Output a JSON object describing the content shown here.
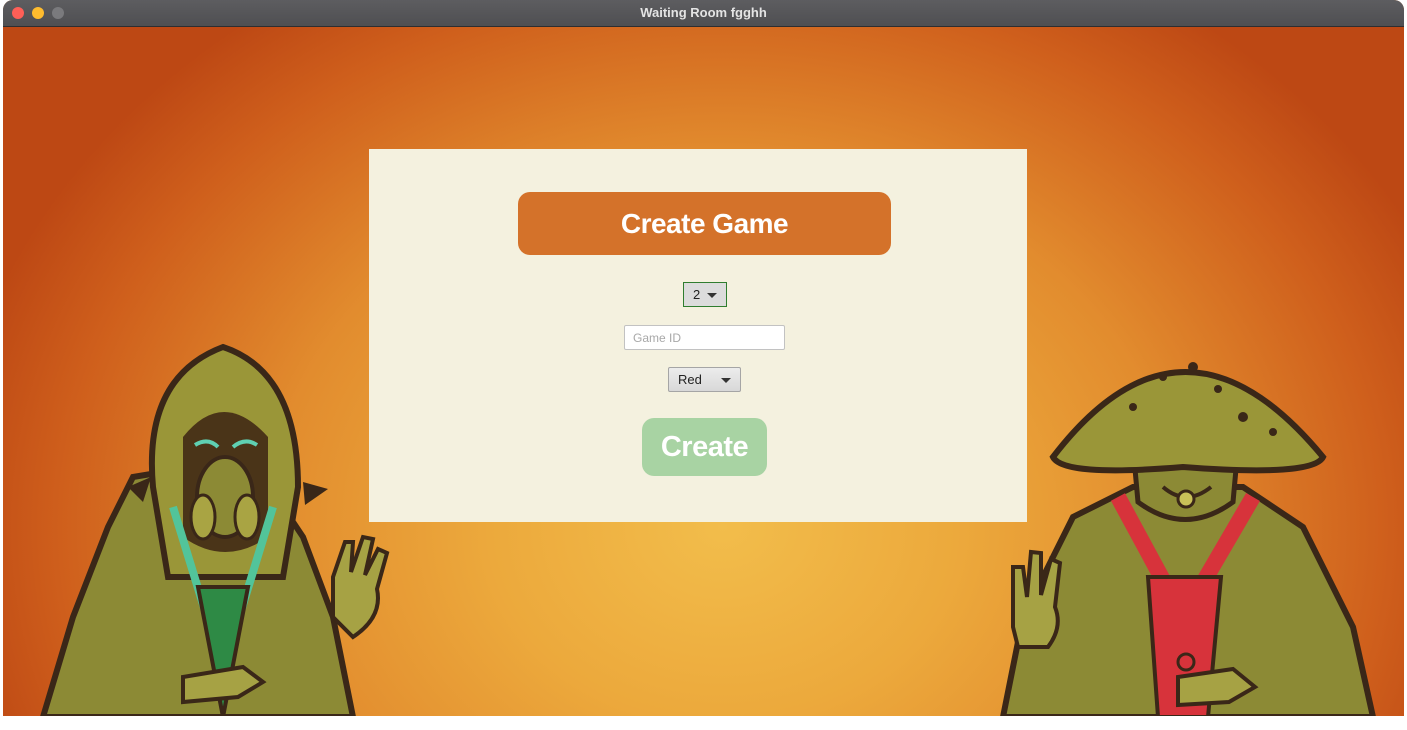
{
  "window": {
    "title": "Waiting Room fgghh"
  },
  "panel": {
    "heading": "Create Game",
    "player_count": {
      "selected": "2"
    },
    "game_id": {
      "value": "",
      "placeholder": "Game ID"
    },
    "color": {
      "selected": "Red"
    },
    "create_label": "Create"
  },
  "colors": {
    "heading_bg": "#d4722a",
    "create_bg": "#a8d3a3",
    "panel_bg": "#f4f1df",
    "select_focus_border": "#2f7d2f"
  },
  "icons": {
    "left_figure": "hooded-green-monk-figure",
    "right_figure": "straw-hat-red-robed-figure"
  }
}
